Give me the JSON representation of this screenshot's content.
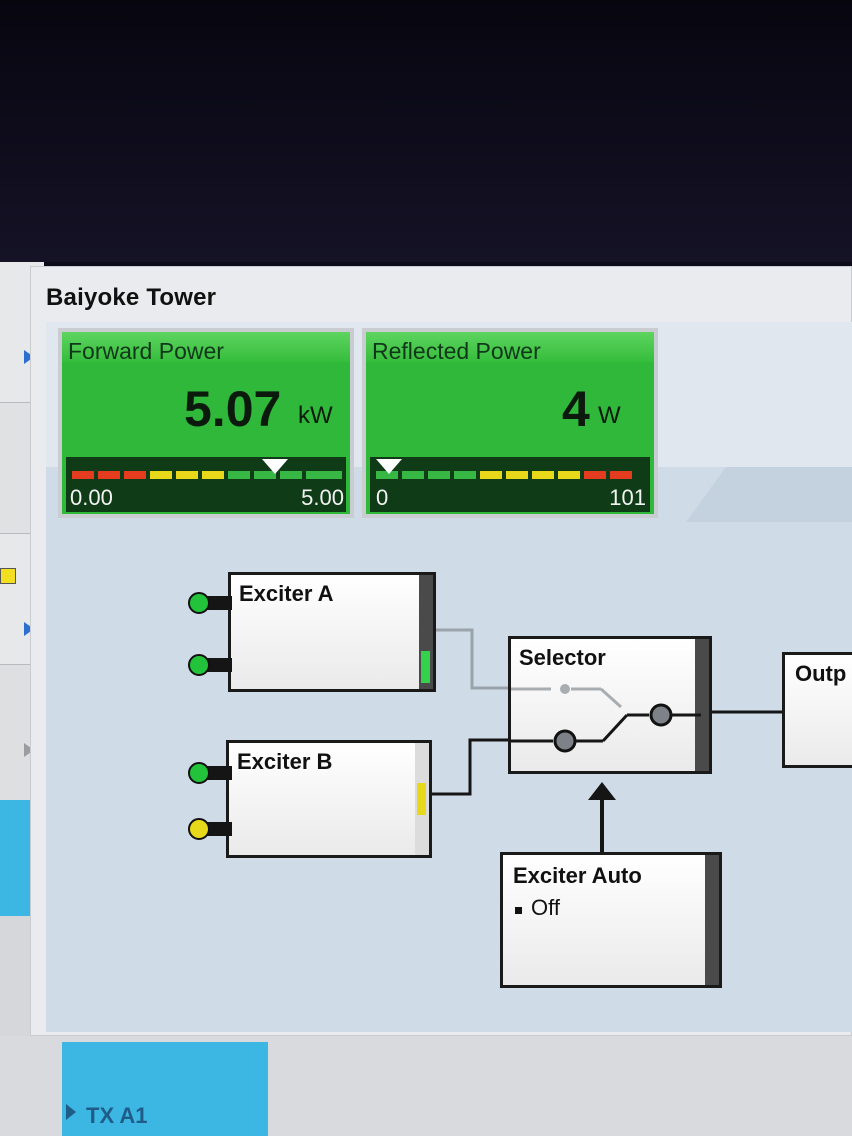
{
  "panel": {
    "title": "Baiyoke Tower"
  },
  "forward_power": {
    "title": "Forward Power",
    "value": "5.07",
    "unit": "kW",
    "scale_min": "0.00",
    "scale_max": "5.00"
  },
  "reflected_power": {
    "title": "Reflected Power",
    "value": "4",
    "unit": "W",
    "scale_min": "0",
    "scale_max": "101"
  },
  "blocks": {
    "exciter_a": "Exciter A",
    "exciter_b": "Exciter B",
    "selector": "Selector",
    "output": "Outp",
    "exciter_auto": "Exciter Auto",
    "exciter_auto_status": "Off"
  },
  "bottom_tab": {
    "label": "TX A1"
  },
  "colors": {
    "meter_green": "#2fb83a",
    "led_green": "#22c33a",
    "led_yellow": "#e8d81a",
    "tab_blue": "#3cb6e3"
  }
}
